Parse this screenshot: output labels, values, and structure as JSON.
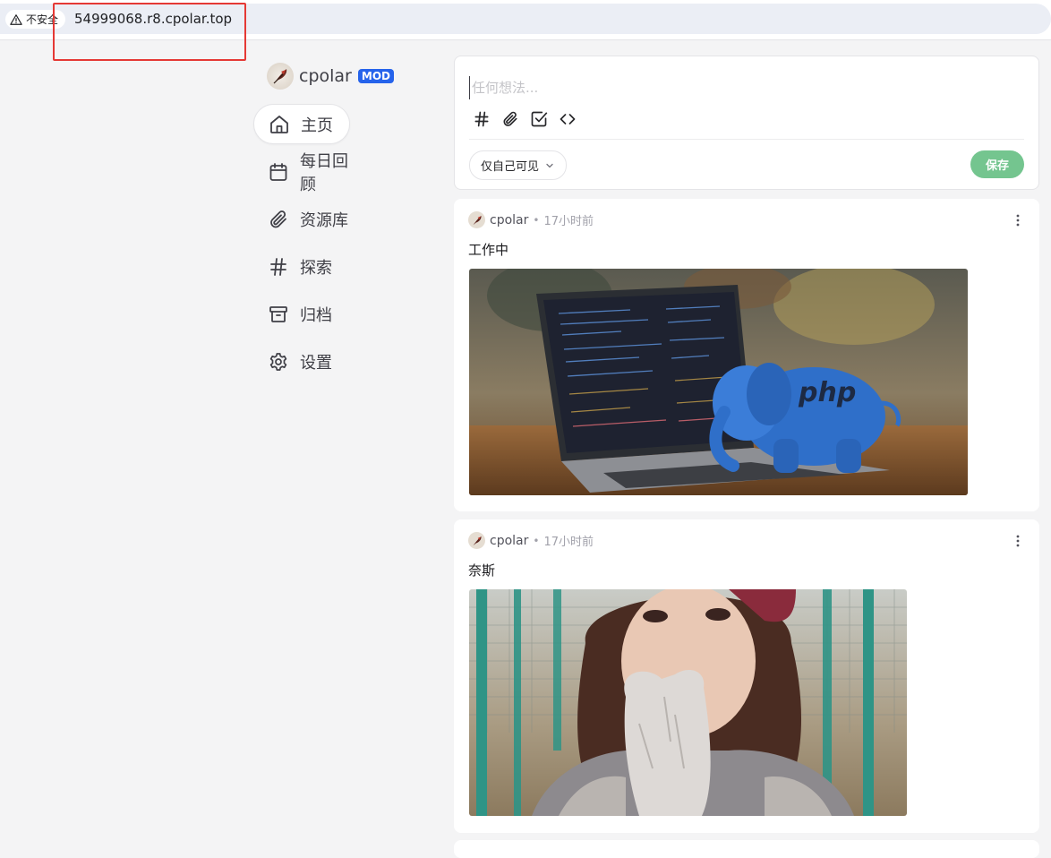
{
  "browser": {
    "security_label": "不安全",
    "security_icon": "warning-triangle-icon",
    "url": "54999068.r8.cpolar.top",
    "highlight_color": "#e53935"
  },
  "brand": {
    "name": "cpolar",
    "badge": "MOD",
    "badge_color": "#2563eb"
  },
  "sidebar": {
    "items": [
      {
        "label": "主页",
        "icon": "home-icon",
        "active": true
      },
      {
        "label": "每日回顾",
        "icon": "calendar-icon",
        "active": false
      },
      {
        "label": "资源库",
        "icon": "paperclip-icon",
        "active": false
      },
      {
        "label": "探索",
        "icon": "hash-icon",
        "active": false
      },
      {
        "label": "归档",
        "icon": "archive-icon",
        "active": false
      },
      {
        "label": "设置",
        "icon": "gear-icon",
        "active": false
      }
    ]
  },
  "editor": {
    "placeholder": "任何想法...",
    "tools": [
      "hash-icon",
      "paperclip-icon",
      "checkbox-icon",
      "code-icon"
    ],
    "visibility": "仅自己可见",
    "save_label": "保存",
    "save_color": "#74c58f"
  },
  "memos": [
    {
      "author": "cpolar",
      "separator": "•",
      "time": "17小时前",
      "content": "工作中",
      "image": "laptop-php-elephant-photo"
    },
    {
      "author": "cpolar",
      "separator": "•",
      "time": "17小时前",
      "content": "奈斯",
      "image": "woman-portrait-photo"
    }
  ]
}
